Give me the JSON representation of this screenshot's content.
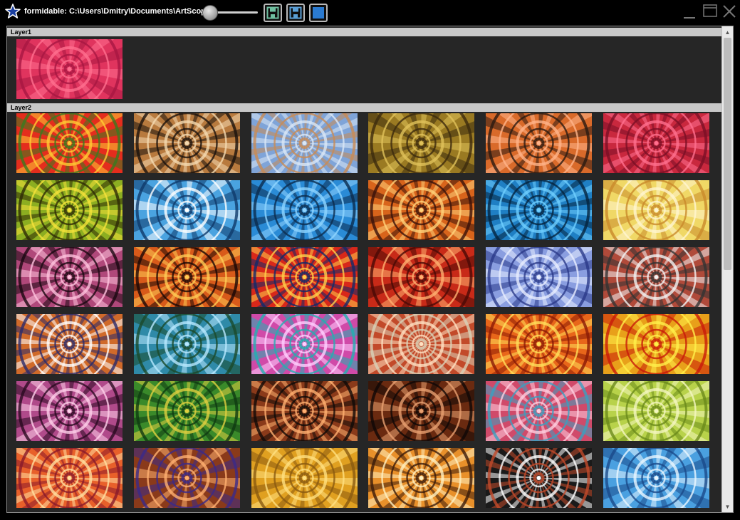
{
  "window": {
    "title": "formidable: C:\\Users\\Dmitry\\Documents\\ArtScope\\",
    "slider_level": 0.1
  },
  "toolbar": {
    "buttons": [
      {
        "icon": "save-icon",
        "color": "#6fbfa0"
      },
      {
        "icon": "save-as-icon",
        "color": "#5a9fd6"
      },
      {
        "icon": "stop-icon",
        "color": "#2a7ad0"
      }
    ]
  },
  "layers": [
    {
      "label": "Layer1",
      "count": 1
    },
    {
      "label": "Layer2",
      "count": 36
    }
  ],
  "thumbnails": [
    {
      "colors": [
        "#ff6f8f",
        "#e0345e",
        "#a81742"
      ]
    },
    {
      "colors": [
        "#ffcc33",
        "#e42d1d",
        "#3a7a1f"
      ]
    },
    {
      "colors": [
        "#f4d9b0",
        "#b87a3e",
        "#1a120c"
      ]
    },
    {
      "colors": [
        "#dbe7f6",
        "#7fa4d8",
        "#c98b54"
      ]
    },
    {
      "colors": [
        "#e0c25a",
        "#9a7a22",
        "#3c2b0e"
      ]
    },
    {
      "colors": [
        "#ffb48a",
        "#d96a2a",
        "#2b1a12"
      ]
    },
    {
      "colors": [
        "#ff6f8f",
        "#c9283e",
        "#7a0f26"
      ]
    },
    {
      "colors": [
        "#f5e23a",
        "#8cae21",
        "#2e2a06"
      ]
    },
    {
      "colors": [
        "#ffffff",
        "#4aa3e0",
        "#0f3a6a"
      ]
    },
    {
      "colors": [
        "#8fd4ff",
        "#2a8bd6",
        "#0b2c4e"
      ]
    },
    {
      "colors": [
        "#ffd27a",
        "#d8641b",
        "#3a120a"
      ]
    },
    {
      "colors": [
        "#6fd0ff",
        "#1f7fc4",
        "#05243e"
      ]
    },
    {
      "colors": [
        "#fff5d0",
        "#f0d866",
        "#c98a2a"
      ]
    },
    {
      "colors": [
        "#ffc2dd",
        "#b0487a",
        "#1a0810"
      ]
    },
    {
      "colors": [
        "#ffcc55",
        "#d85a1a",
        "#1a0806"
      ]
    },
    {
      "colors": [
        "#ffd04a",
        "#d8281a",
        "#102a6a"
      ]
    },
    {
      "colors": [
        "#ffb070",
        "#c82a18",
        "#4a0a06"
      ]
    },
    {
      "colors": [
        "#e8eeff",
        "#8a9ee0",
        "#2a3a8a"
      ]
    },
    {
      "colors": [
        "#f2f2f2",
        "#b04a3a",
        "#333333"
      ]
    },
    {
      "colors": [
        "#ffffff",
        "#d06a2a",
        "#2a2a6a"
      ]
    },
    {
      "colors": [
        "#b8e8ff",
        "#2f8aa8",
        "#1a4a2a"
      ]
    },
    {
      "colors": [
        "#ffd0ff",
        "#d04aa8",
        "#20b0b0"
      ]
    },
    {
      "colors": [
        "#ffe0c0",
        "#c24a2a",
        "#d8d2b8"
      ]
    },
    {
      "colors": [
        "#ffe05a",
        "#e8661a",
        "#8a1a06"
      ]
    },
    {
      "colors": [
        "#fff04a",
        "#e8a01a",
        "#c81a0a"
      ]
    },
    {
      "colors": [
        "#ffd0ea",
        "#b04a8a",
        "#2a0a20"
      ]
    },
    {
      "colors": [
        "#e0d040",
        "#3a8a2a",
        "#0f3a12"
      ]
    },
    {
      "colors": [
        "#ffb070",
        "#8a3a1a",
        "#0f0a08"
      ]
    },
    {
      "colors": [
        "#e8a070",
        "#6a2a10",
        "#0f0806"
      ]
    },
    {
      "colors": [
        "#ffd0e0",
        "#d04a6a",
        "#3aa0c0"
      ]
    },
    {
      "colors": [
        "#f4f6c0",
        "#b8d24a",
        "#6a8a1a"
      ]
    },
    {
      "colors": [
        "#ffe0a0",
        "#e8602a",
        "#8a1a2a"
      ]
    },
    {
      "colors": [
        "#ffb070",
        "#8a3a1a",
        "#3a2a8a"
      ]
    },
    {
      "colors": [
        "#ffe080",
        "#e0a020",
        "#8a5a10"
      ]
    },
    {
      "colors": [
        "#fff0c0",
        "#e8902a",
        "#3a1a0a"
      ]
    },
    {
      "colors": [
        "#ffffff",
        "#1a1a1a",
        "#c24a2a"
      ]
    },
    {
      "colors": [
        "#e8f6ff",
        "#4aa0e0",
        "#1a4a8a"
      ]
    }
  ]
}
